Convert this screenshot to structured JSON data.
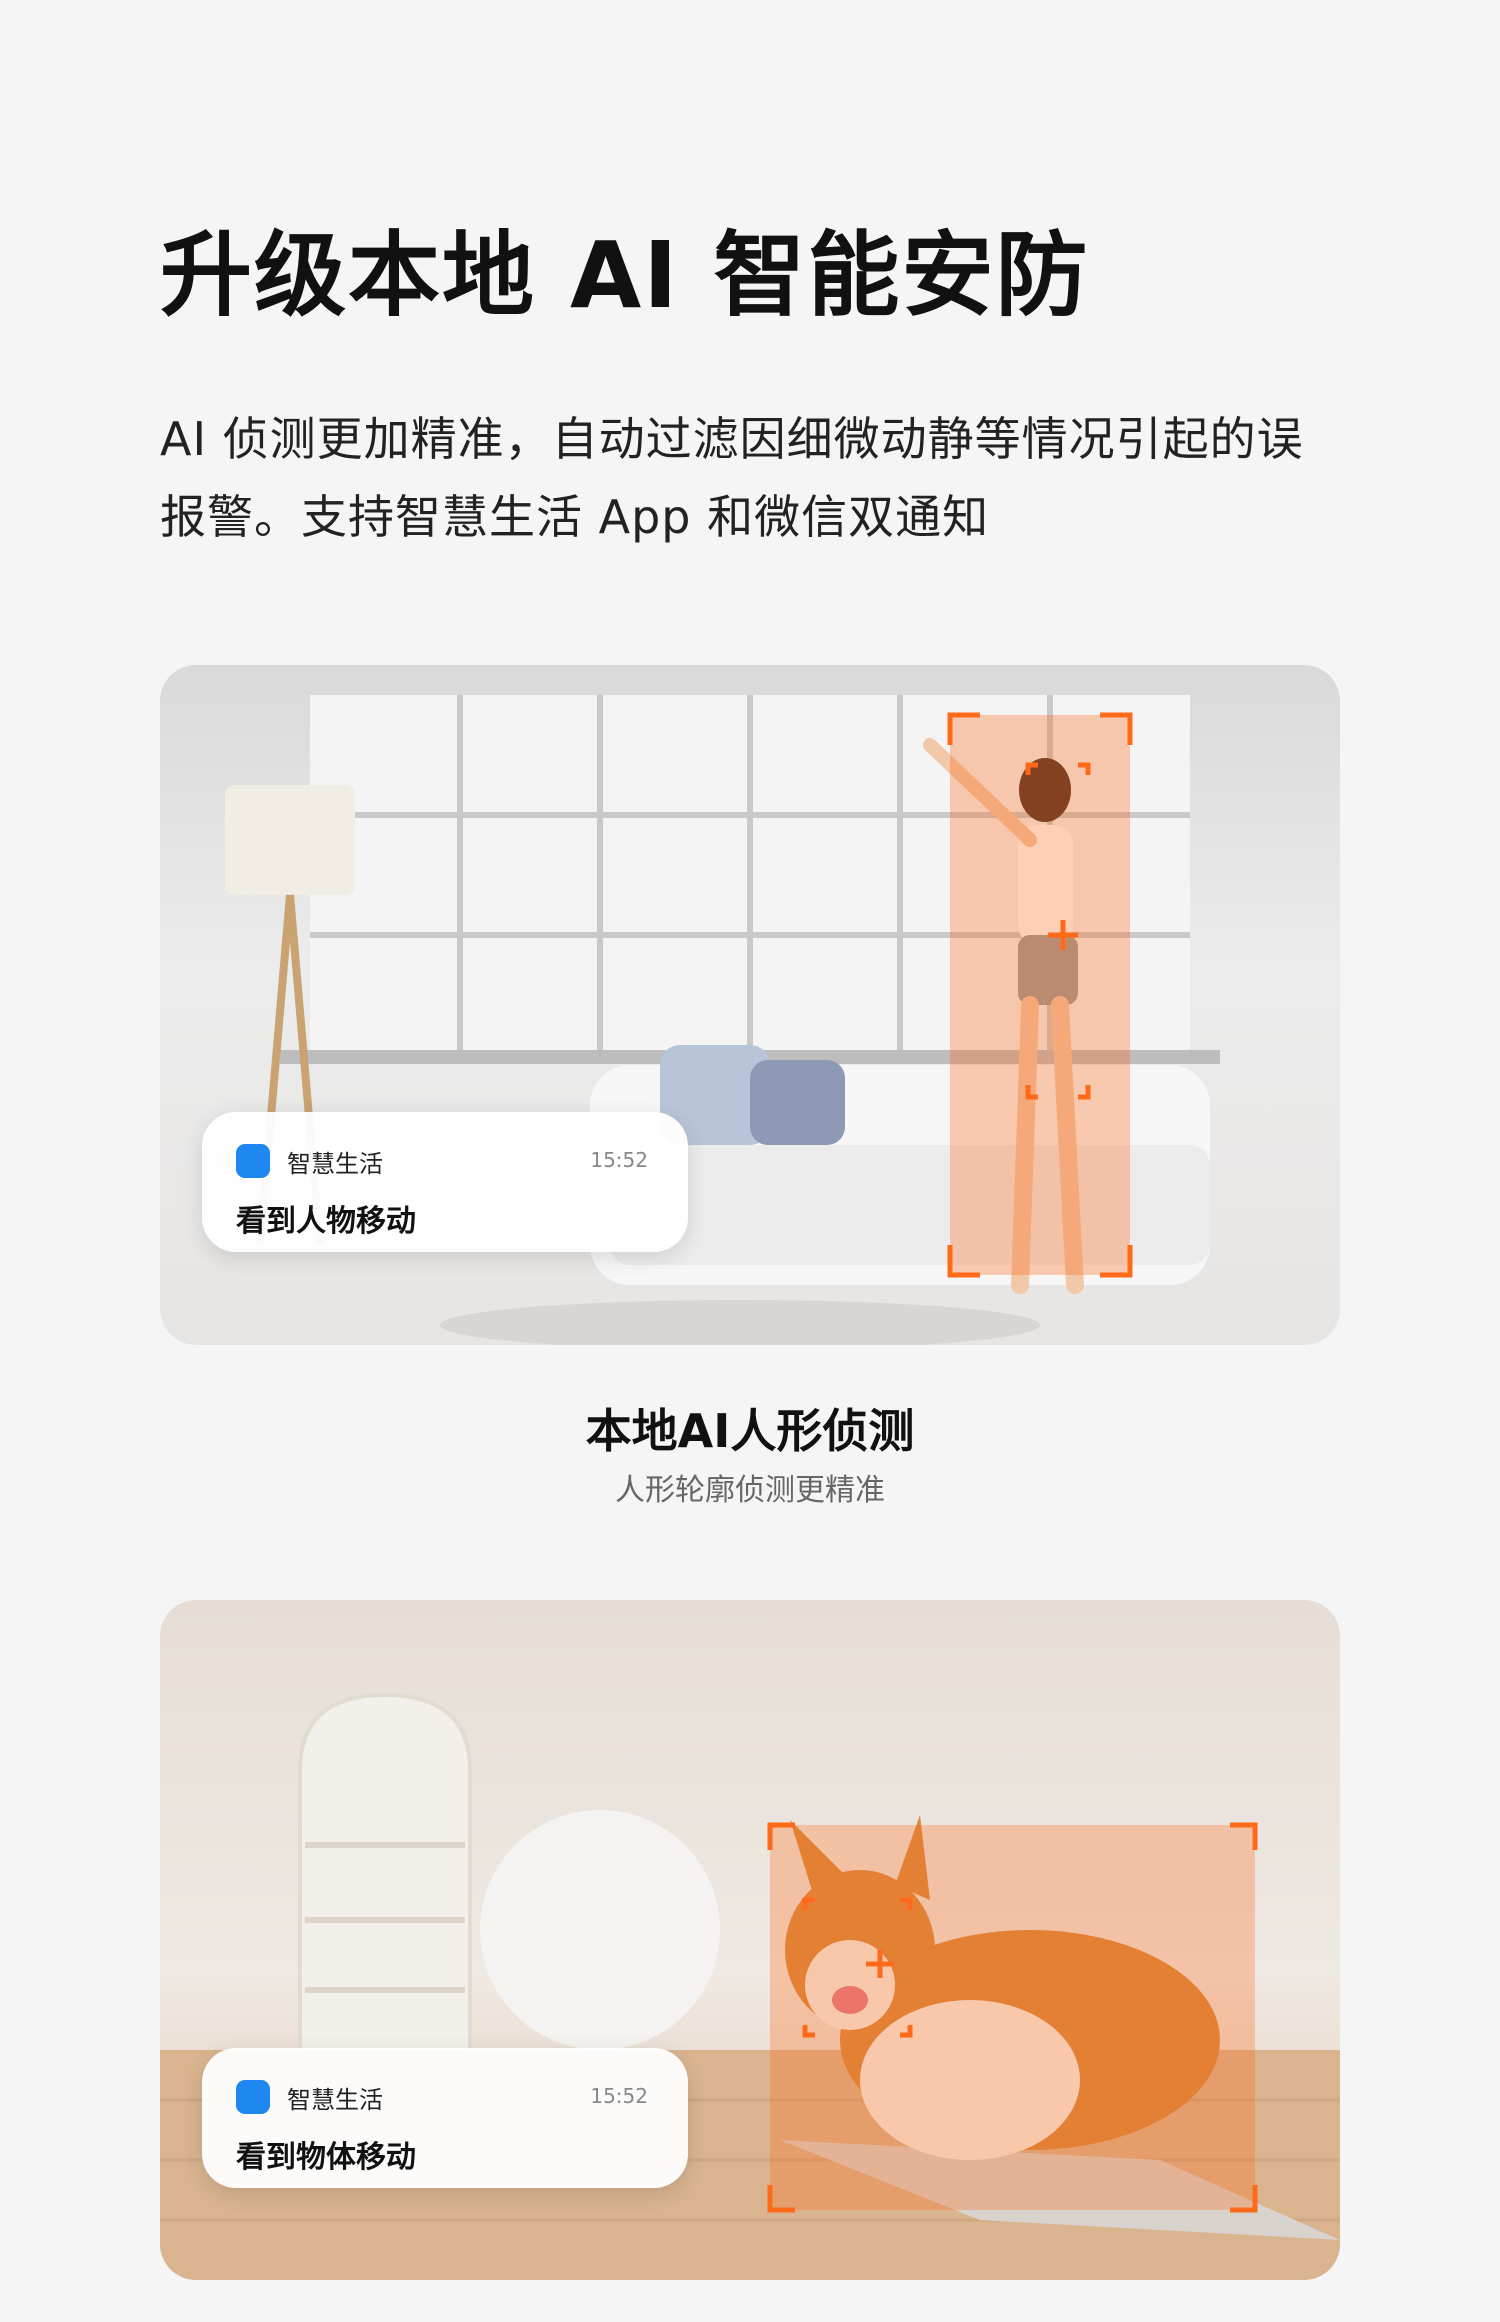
{
  "headline": "升级本地 AI 智能安防",
  "subtext_line1": "AI 侦测更加精准，自动过滤因细微动静等情况引起的误",
  "subtext_line2": "报警。支持智慧生活 App 和微信双通知",
  "card1": {
    "notification": {
      "app_icon": "smart-life-app-icon",
      "app_name": "智慧生活",
      "time": "15:52",
      "message": "看到人物移动"
    },
    "caption_title": "本地AI人形侦测",
    "caption_sub": "人形轮廓侦测更精准"
  },
  "card2": {
    "notification": {
      "app_icon": "smart-life-app-icon",
      "app_name": "智慧生活",
      "time": "15:52",
      "message": "看到物体移动"
    }
  },
  "colors": {
    "detect_orange": "#ff6a1a",
    "app_blue": "#1e88f0"
  }
}
